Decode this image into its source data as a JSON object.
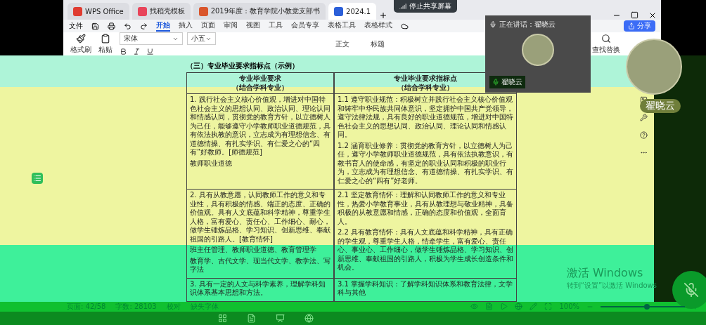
{
  "share_banner": {
    "label": "停止共享屏幕"
  },
  "tabs": [
    {
      "label": "WPS Office",
      "kind": "home",
      "selected": false
    },
    {
      "label": "找稻壳模板",
      "kind": "template",
      "selected": false
    },
    {
      "label": "2019年度：教育学院小教党支部书",
      "kind": "slides",
      "selected": false
    },
    {
      "label": "2024.1",
      "kind": "doc",
      "selected": true
    }
  ],
  "menu": {
    "file": "文件",
    "ribbon_tabs": [
      {
        "label": "开始",
        "selected": true
      },
      {
        "label": "插入",
        "selected": false
      },
      {
        "label": "页面",
        "selected": false
      },
      {
        "label": "审阅",
        "selected": false
      },
      {
        "label": "视图",
        "selected": false
      },
      {
        "label": "工具",
        "selected": false
      },
      {
        "label": "会员专享",
        "selected": false
      },
      {
        "label": "表格工具",
        "selected": false
      },
      {
        "label": "表格样式",
        "selected": false
      }
    ],
    "share": "分享"
  },
  "toolbar": {
    "format_painter": "格式刷",
    "paste": "粘贴",
    "font": "宋体",
    "size": "小五",
    "styles": [
      "正文",
      "标题"
    ],
    "find": "查找替换"
  },
  "call": {
    "speaking": "正在讲话：翟晓云",
    "participant": "翟晓云",
    "name_tag": "翟晓云",
    "mic_muted": true
  },
  "document": {
    "heading": "（三）专业毕业要求指标点（示例）",
    "columns": [
      {
        "title": "专业毕业要求",
        "subtitle": "（结合学科专业）"
      },
      {
        "title": "专业毕业要求指标点",
        "subtitle": "（结合学科专业）"
      }
    ],
    "rows": [
      {
        "requirement": [
          "1. 践行社会主义核心价值观，增进对中国特色社会主义的思想认同、政治认同、理论认同和情感认同，贯彻党的教育方针，以立德树人为己任，能够遵守小学教师职业道德规范，具有依法执教的意识，立志成为有理想信念、有道德情操、有扎实学识、有仁爱之心的“四有”好教师。[师德规范]",
          "教师职业道德"
        ],
        "indicators": [
          "1.1 遵守职业规范：积极树立并践行社会主义核心价值观和铸牢中华民族共同体意识，坚定拥护中国共产党领导，遵守法律法规，具有良好的职业道德规范，增进对中国特色社会主义的思想认同、政治认同、理论认同和情感认同。",
          "1.2 涵育职业修养：贯彻党的教育方针，以立德树人为己任，遵守小学教师职业道德规范，具有依法执教意识，有教书育人的使命感，有坚定的职业认同和积极的职业行为，立志成为有理想信念、有道德情操、有扎实学识、有仁爱之心的“四有”好老师。"
        ]
      },
      {
        "requirement": [
          "2. 具有从教意愿，认同教师工作的意义和专业性，具有积极的情感、端正的态度、正确的价值观。具有人文底蕴和科学精神，尊重学生人格，富有爱心、责任心、工作细心、耐心，做学生锤炼品格、学习知识、创新思维、奉献祖国的引路人。[教育情怀]",
          "班主任管理、教师职业道德、教育管理学",
          "教育学、古代文学、现当代文学、教学法、写字法"
        ],
        "indicators": [
          "2.1 坚定教育情怀：理解和认同教师工作的意义和专业性，热爱小学教育事业，具有从教理想与敬业精神，具备积极的从教意愿和情感，正确的态度和价值观，全面育人。",
          "2.2 具有教育情怀：具有人文底蕴和科学精神，具有正确的学生观，尊重学生人格，情牵学生，富有爱心、责任心、事业心、工作细心，做学生锤炼品格、学习知识、创新思维、奉献祖国的引路人，积极为学生成长创造条件和机会。"
        ]
      },
      {
        "requirement": [
          "3. 具有一定的人文与科学素养，理解学科知识体系基本思想和方法。"
        ],
        "indicators": [
          "3.1 掌握学科知识：了解学科知识体系和教育法律，文学科与其他"
        ]
      }
    ]
  },
  "status_bar": {
    "page": "页面: 42/58",
    "words": "字数: 28103",
    "proofread": "校对",
    "missing_fonts": "缺失字体",
    "zoom": "100%",
    "level": 0.55
  },
  "watermark": {
    "title": "激活 Windows",
    "hint": "转到“设置”以激活 Windows"
  }
}
